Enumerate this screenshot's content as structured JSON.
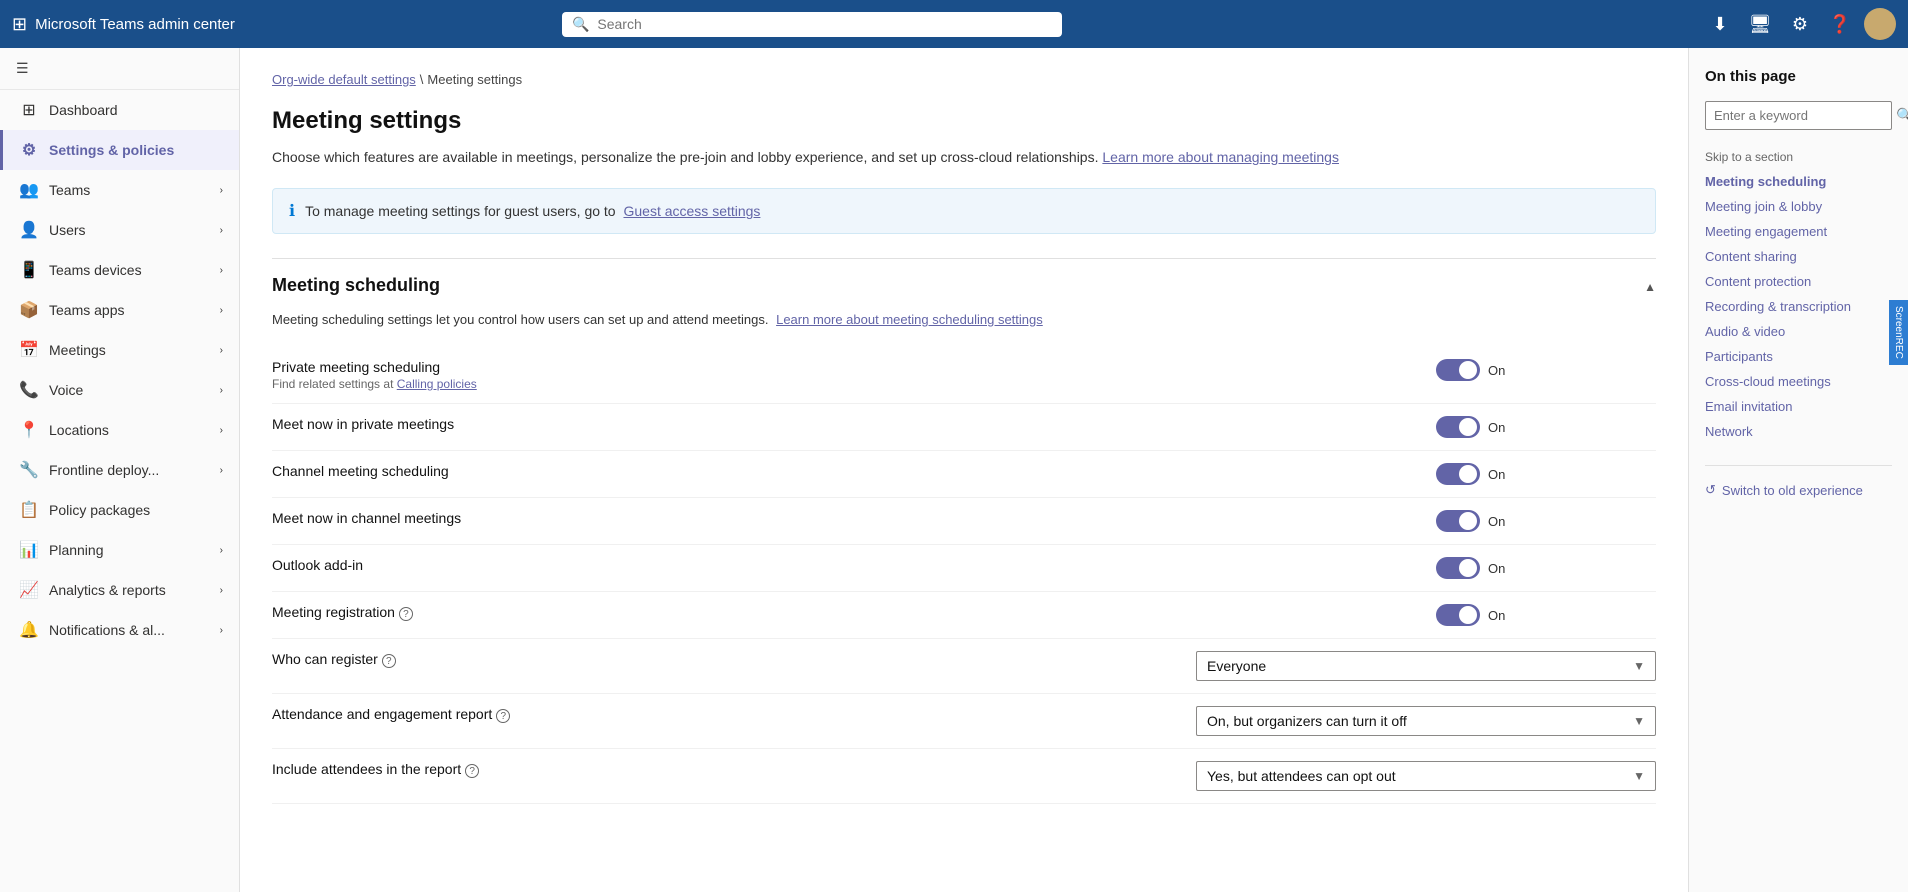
{
  "topbar": {
    "app_name": "Microsoft Teams admin center",
    "search_placeholder": "Search",
    "icons": [
      "download",
      "screen",
      "settings",
      "help"
    ]
  },
  "sidebar": {
    "toggle_icon": "≡",
    "nav_items": [
      {
        "id": "dashboard",
        "label": "Dashboard",
        "icon": "⊞",
        "active": false,
        "has_children": false
      },
      {
        "id": "settings-policies",
        "label": "Settings & policies",
        "icon": "⚙",
        "active": true,
        "has_children": false
      },
      {
        "id": "teams",
        "label": "Teams",
        "icon": "👥",
        "active": false,
        "has_children": true
      },
      {
        "id": "users",
        "label": "Users",
        "icon": "👤",
        "active": false,
        "has_children": true
      },
      {
        "id": "teams-devices",
        "label": "Teams devices",
        "icon": "📱",
        "active": false,
        "has_children": true
      },
      {
        "id": "teams-apps",
        "label": "Teams apps",
        "icon": "📦",
        "active": false,
        "has_children": true
      },
      {
        "id": "meetings",
        "label": "Meetings",
        "icon": "📅",
        "active": false,
        "has_children": true
      },
      {
        "id": "voice",
        "label": "Voice",
        "icon": "📞",
        "active": false,
        "has_children": true
      },
      {
        "id": "locations",
        "label": "Locations",
        "icon": "📍",
        "active": false,
        "has_children": true
      },
      {
        "id": "frontline-deploy",
        "label": "Frontline deploy...",
        "icon": "🔧",
        "active": false,
        "has_children": true
      },
      {
        "id": "policy-packages",
        "label": "Policy packages",
        "icon": "📋",
        "active": false,
        "has_children": false
      },
      {
        "id": "planning",
        "label": "Planning",
        "icon": "📊",
        "active": false,
        "has_children": true
      },
      {
        "id": "analytics-reports",
        "label": "Analytics & reports",
        "icon": "📈",
        "active": false,
        "has_children": true
      },
      {
        "id": "notifications",
        "label": "Notifications & al...",
        "icon": "🔔",
        "active": false,
        "has_children": true
      }
    ]
  },
  "breadcrumb": {
    "parent": "Org-wide default settings",
    "separator": "\\",
    "current": "Meeting settings"
  },
  "page": {
    "title": "Meeting settings",
    "description": "Choose which features are available in meetings, personalize the pre-join and lobby experience, and set up cross-cloud relationships.",
    "learn_more_text": "Learn more about managing meetings",
    "learn_more_url": "#"
  },
  "info_banner": {
    "text": "To manage meeting settings for guest users, go to",
    "link_text": "Guest access settings",
    "link_url": "#"
  },
  "meeting_scheduling": {
    "section_title": "Meeting scheduling",
    "section_desc": "Meeting scheduling settings let you control how users can set up and attend meetings.",
    "learn_more_text": "Learn more about meeting scheduling settings",
    "learn_more_url": "#",
    "settings": [
      {
        "id": "private-meeting-scheduling",
        "label": "Private meeting scheduling",
        "sublabel": "Find related settings at",
        "sublabel_link": "Calling policies",
        "type": "toggle",
        "value": true,
        "value_text": "On"
      },
      {
        "id": "meet-now-private",
        "label": "Meet now in private meetings",
        "sublabel": "",
        "sublabel_link": "",
        "type": "toggle",
        "value": true,
        "value_text": "On"
      },
      {
        "id": "channel-meeting-scheduling",
        "label": "Channel meeting scheduling",
        "sublabel": "",
        "sublabel_link": "",
        "type": "toggle",
        "value": true,
        "value_text": "On"
      },
      {
        "id": "meet-now-channel",
        "label": "Meet now in channel meetings",
        "sublabel": "",
        "sublabel_link": "",
        "type": "toggle",
        "value": true,
        "value_text": "On"
      },
      {
        "id": "outlook-addin",
        "label": "Outlook add-in",
        "sublabel": "",
        "sublabel_link": "",
        "type": "toggle",
        "value": true,
        "value_text": "On"
      },
      {
        "id": "meeting-registration",
        "label": "Meeting registration",
        "has_info": true,
        "sublabel": "",
        "sublabel_link": "",
        "type": "toggle",
        "value": true,
        "value_text": "On"
      },
      {
        "id": "who-can-register",
        "label": "Who can register",
        "has_info": true,
        "type": "dropdown",
        "value": "Everyone"
      },
      {
        "id": "attendance-engagement-report",
        "label": "Attendance and engagement report",
        "has_info": true,
        "type": "dropdown",
        "value": "On, but organizers can turn it off"
      },
      {
        "id": "include-attendees-report",
        "label": "Include attendees in the report",
        "has_info": true,
        "type": "dropdown",
        "value": "Yes, but attendees can opt out"
      }
    ]
  },
  "on_this_page": {
    "title": "On this page",
    "keyword_placeholder": "Enter a keyword",
    "skip_label": "Skip to a section",
    "links": [
      {
        "id": "meeting-scheduling",
        "label": "Meeting scheduling",
        "active": true
      },
      {
        "id": "meeting-join-lobby",
        "label": "Meeting join & lobby",
        "active": false
      },
      {
        "id": "meeting-engagement",
        "label": "Meeting engagement",
        "active": false
      },
      {
        "id": "content-sharing",
        "label": "Content sharing",
        "active": false
      },
      {
        "id": "content-protection",
        "label": "Content protection",
        "active": false
      },
      {
        "id": "recording-transcription",
        "label": "Recording & transcription",
        "active": false
      },
      {
        "id": "audio-video",
        "label": "Audio & video",
        "active": false
      },
      {
        "id": "participants",
        "label": "Participants",
        "active": false
      },
      {
        "id": "cross-cloud-meetings",
        "label": "Cross-cloud meetings",
        "active": false
      },
      {
        "id": "email-invitation",
        "label": "Email invitation",
        "active": false
      },
      {
        "id": "network",
        "label": "Network",
        "active": false
      }
    ]
  },
  "switch_old": {
    "label": "Switch to old experience",
    "icon": "↺"
  }
}
